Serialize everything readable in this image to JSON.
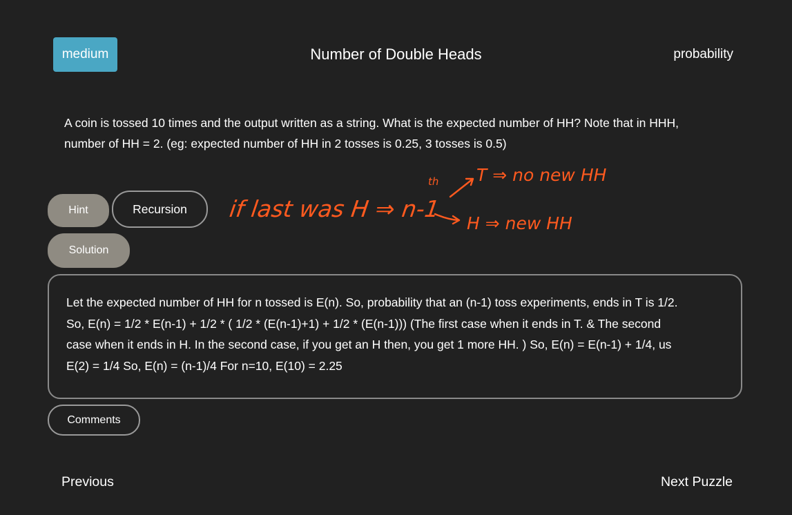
{
  "header": {
    "difficulty": "medium",
    "title": "Number of Double Heads",
    "category": "probability"
  },
  "question": {
    "line1": "A coin is tossed 10 times and the output written as a string. What is the expected number of HH? Note that in HHH,",
    "line2": "number of HH = 2. (eg: expected number of HH in 2 tosses is 0.25, 3 tosses is 0.5)"
  },
  "buttons": {
    "hint": "Hint",
    "recursion": "Recursion",
    "solution": "Solution",
    "comments": "Comments"
  },
  "annotation": {
    "ink_color": "#ff5a1f",
    "text_left": "if last was H ⇒ n-1",
    "superscript": "th",
    "branch_top": "T ⇒ no new HH",
    "branch_bottom": "H ⇒ new HH"
  },
  "solution": {
    "lines": [
      "Let the expected number of HH for n tossed is E(n). So, probability that an (n-1) toss experiments, ends in T is 1/2.",
      "So, E(n) = 1/2 * E(n-1) + 1/2 * ( 1/2 * (E(n-1)+1) + 1/2 * (E(n-1))) (The first case when it ends in T. & The second",
      "case when it ends in H. In the second case, if you get an H then, you get 1 more HH. ) So, E(n) = E(n-1) + 1/4, us",
      "E(2) = 1/4 So, E(n) = (n-1)/4 For n=10, E(10) = 2.25"
    ]
  },
  "nav": {
    "previous": "Previous",
    "next": "Next Puzzle"
  }
}
